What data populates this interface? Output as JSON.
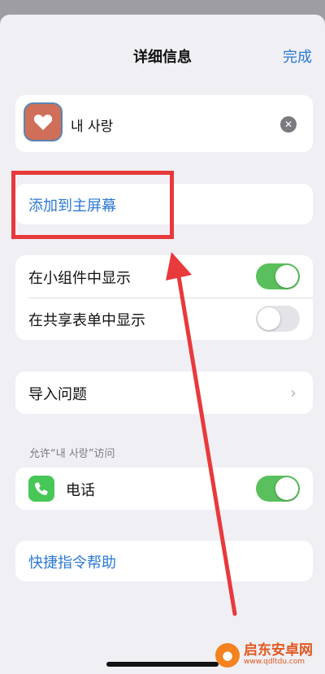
{
  "header": {
    "title": "详细信息",
    "done_label": "完成"
  },
  "shortcut": {
    "name": "내 사랑",
    "icon": "heart-icon",
    "clear_icon": "clear-icon"
  },
  "add_to_home": {
    "label": "添加到主屏幕"
  },
  "display_options": [
    {
      "label": "在小组件中显示",
      "enabled": true
    },
    {
      "label": "在共享表单中显示",
      "enabled": false
    }
  ],
  "import": {
    "label": "导入问题"
  },
  "permissions": {
    "header": "允许“내 사랑”访问",
    "items": [
      {
        "label": "电话",
        "icon": "phone-icon",
        "enabled": true
      }
    ]
  },
  "help": {
    "label": "快捷指令帮助"
  },
  "watermark": {
    "title": "启东安卓网",
    "url": "www.qdltdu.com"
  },
  "colors": {
    "accent": "#2b78d6",
    "toggle_on": "#5ac05d",
    "annotation_red": "#e8393c",
    "shortcut_icon_bg": "#cf6f59"
  }
}
